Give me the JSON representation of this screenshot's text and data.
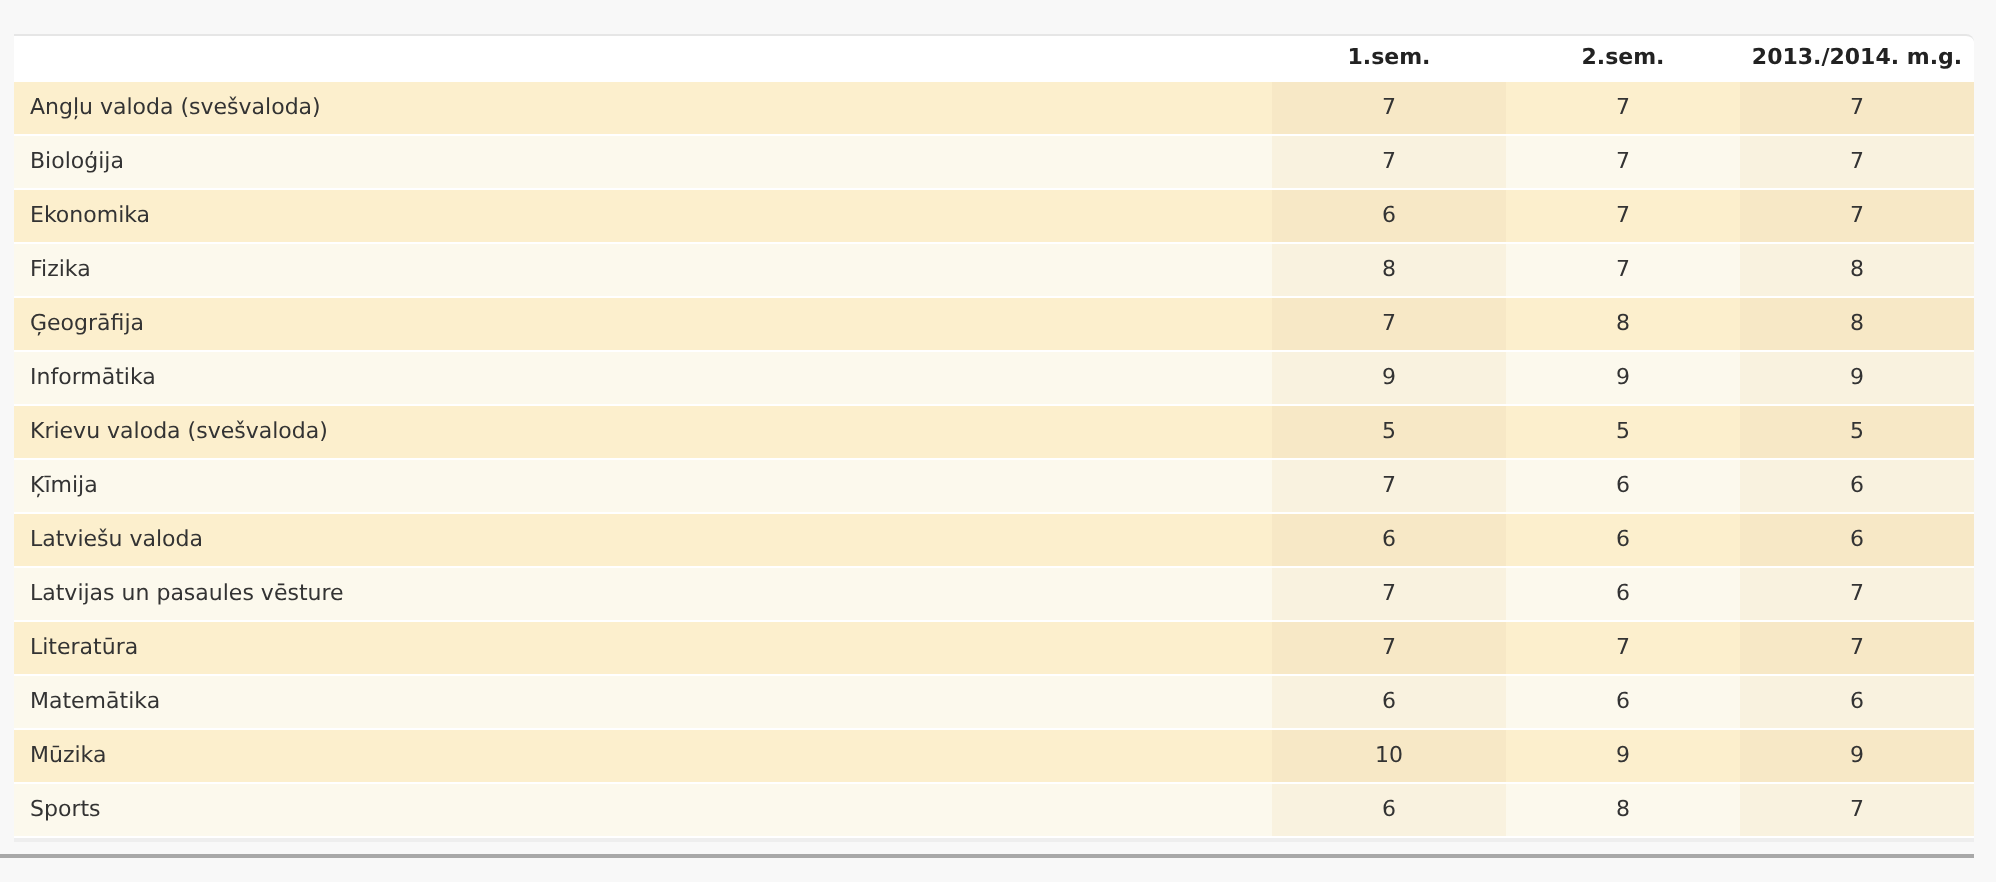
{
  "table": {
    "columns": [
      "",
      "1.sem.",
      "2.sem.",
      "2013./2014. m.g."
    ],
    "rows": [
      {
        "subject": "Angļu valoda (svešvaloda)",
        "grades": [
          "7",
          "7",
          "7"
        ]
      },
      {
        "subject": "Bioloģija",
        "grades": [
          "7",
          "7",
          "7"
        ]
      },
      {
        "subject": "Ekonomika",
        "grades": [
          "6",
          "7",
          "7"
        ]
      },
      {
        "subject": "Fizika",
        "grades": [
          "8",
          "7",
          "8"
        ]
      },
      {
        "subject": "Ģeogrāfija",
        "grades": [
          "7",
          "8",
          "8"
        ]
      },
      {
        "subject": "Informātika",
        "grades": [
          "9",
          "9",
          "9"
        ]
      },
      {
        "subject": "Krievu valoda (svešvaloda)",
        "grades": [
          "5",
          "5",
          "5"
        ]
      },
      {
        "subject": "Ķīmija",
        "grades": [
          "7",
          "6",
          "6"
        ]
      },
      {
        "subject": "Latviešu valoda",
        "grades": [
          "6",
          "6",
          "6"
        ]
      },
      {
        "subject": "Latvijas un pasaules vēsture",
        "grades": [
          "7",
          "6",
          "7"
        ]
      },
      {
        "subject": "Literatūra",
        "grades": [
          "7",
          "7",
          "7"
        ]
      },
      {
        "subject": "Matemātika",
        "grades": [
          "6",
          "6",
          "6"
        ]
      },
      {
        "subject": "Mūzika",
        "grades": [
          "10",
          "9",
          "9"
        ]
      },
      {
        "subject": "Sports",
        "grades": [
          "6",
          "8",
          "7"
        ]
      }
    ]
  }
}
